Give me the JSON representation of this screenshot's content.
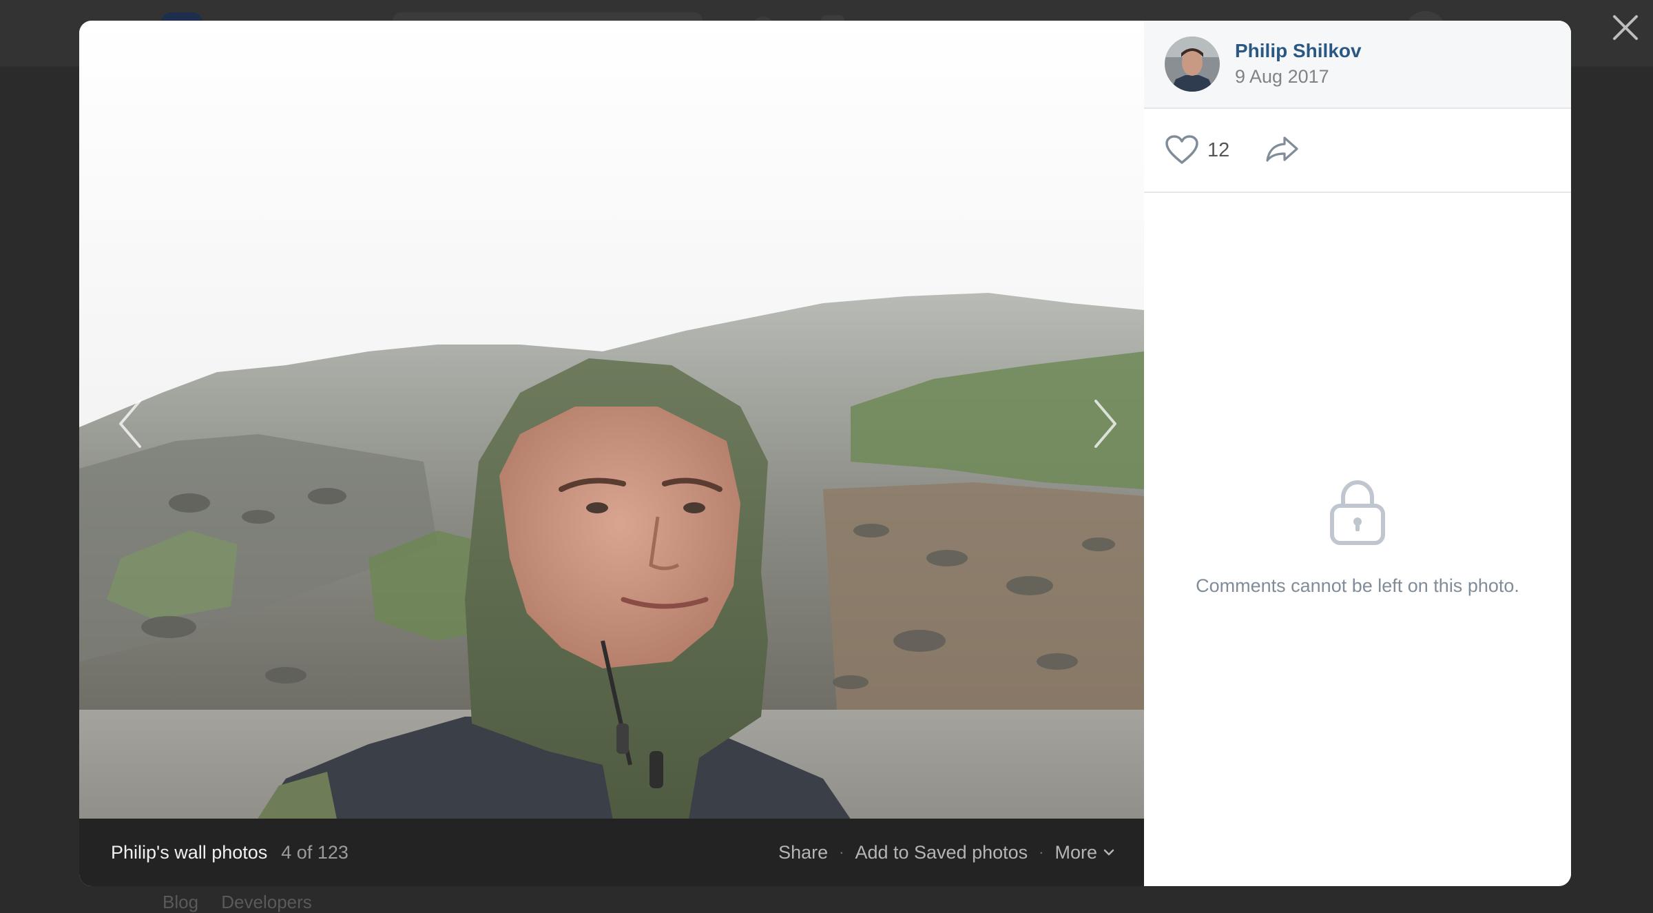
{
  "background": {
    "footer_links": [
      "Blog",
      "Developers"
    ]
  },
  "modal": {
    "photo": {
      "album_title": "Philip's wall photos",
      "counter": "4 of 123"
    },
    "bar_actions": {
      "share": "Share",
      "separator": "·",
      "add_saved": "Add to Saved photos",
      "more": "More"
    },
    "side": {
      "author_name": "Philip Shilkov",
      "date": "9 Aug 2017",
      "likes": "12",
      "comments_locked_text": "Comments cannot be left on this photo."
    }
  },
  "colors": {
    "link_blue": "#2a5885",
    "muted_gray": "#818c99",
    "photo_bar": "#232323"
  },
  "icons": [
    "close-icon",
    "chevron-left-icon",
    "chevron-right-icon",
    "heart-icon",
    "share-arrow-icon",
    "lock-icon",
    "chevron-down-icon"
  ]
}
